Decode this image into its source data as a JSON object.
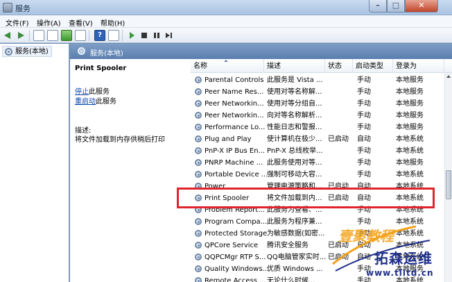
{
  "window": {
    "title": "服务"
  },
  "menu": [
    "文件(F)",
    "操作(A)",
    "查看(V)",
    "帮助(H)"
  ],
  "tree": {
    "item": "服务(本地)"
  },
  "panel": {
    "title": "服务(本地)"
  },
  "detail": {
    "service_name": "Print Spooler",
    "stop_link": "停止",
    "stop_suffix": "此服务",
    "restart_link": "重启动",
    "restart_suffix": "此服务",
    "description_label": "描述:",
    "description_text": "将文件加载到内存供稍后打印"
  },
  "table": {
    "columns": [
      "名称",
      "描述",
      "状态",
      "启动类型",
      "登录为"
    ],
    "rows": [
      {
        "name": "Parental Controls",
        "desc": "此服务是 Vista ...",
        "status": "",
        "startup": "手动",
        "logon": "本地服务"
      },
      {
        "name": "Peer Name Res...",
        "desc": "使用对等名称解...",
        "status": "",
        "startup": "手动",
        "logon": "本地服务"
      },
      {
        "name": "Peer Networkin...",
        "desc": "使用对等分组自...",
        "status": "",
        "startup": "手动",
        "logon": "本地服务"
      },
      {
        "name": "Peer Networkin...",
        "desc": "向对等名称解析...",
        "status": "",
        "startup": "手动",
        "logon": "本地服务"
      },
      {
        "name": "Performance Lo...",
        "desc": "性能日志和警报...",
        "status": "",
        "startup": "手动",
        "logon": "本地服务"
      },
      {
        "name": "Plug and Play",
        "desc": "使计算机在极少...",
        "status": "已启动",
        "startup": "自动",
        "logon": "本地系统"
      },
      {
        "name": "PnP-X IP Bus En...",
        "desc": "PnP-X 总线枚举...",
        "status": "",
        "startup": "手动",
        "logon": "本地系统"
      },
      {
        "name": "PNRP Machine ...",
        "desc": "此服务使用对等...",
        "status": "",
        "startup": "手动",
        "logon": "本地服务"
      },
      {
        "name": "Portable Device ...",
        "desc": "强制可移动大容...",
        "status": "",
        "startup": "手动",
        "logon": "本地系统"
      },
      {
        "name": "Power",
        "desc": "管理电源策略和...",
        "status": "已启动",
        "startup": "自动",
        "logon": "本地系统"
      },
      {
        "name": "Print Spooler",
        "desc": "将文件加载到内...",
        "status": "已启动",
        "startup": "自动",
        "logon": "本地系统"
      },
      {
        "name": "Problem Report...",
        "desc": "此服务为查看、...",
        "status": "",
        "startup": "手动",
        "logon": "本地系统"
      },
      {
        "name": "Program Compa...",
        "desc": "此服务为程序兼...",
        "status": "",
        "startup": "手动",
        "logon": "本地系统"
      },
      {
        "name": "Protected Storage",
        "desc": "为敏感数据(如密...",
        "status": "",
        "startup": "手动",
        "logon": "本地系统"
      },
      {
        "name": "QPCore Service",
        "desc": "腾讯安全服务",
        "status": "已启动",
        "startup": "自动",
        "logon": "本地系统"
      },
      {
        "name": "QQPCMgr RTP S...",
        "desc": "QQ电脑管家实时...",
        "status": "已启动",
        "startup": "自动",
        "logon": "本地系统"
      },
      {
        "name": "Quality Windows...",
        "desc": "优质 Windows ...",
        "status": "",
        "startup": "手动",
        "logon": "本地服务"
      },
      {
        "name": "Remote Access ...",
        "desc": "无论什么时候...",
        "status": "",
        "startup": "手动",
        "logon": "本地系统"
      }
    ]
  },
  "watermark": {
    "logo": "壹聚教程",
    "name": "拓森运维",
    "url": "www.tlltd.cn"
  },
  "colors": {
    "highlight": "#e0232d",
    "link": "#0645ad",
    "header": "#5a7eae"
  }
}
